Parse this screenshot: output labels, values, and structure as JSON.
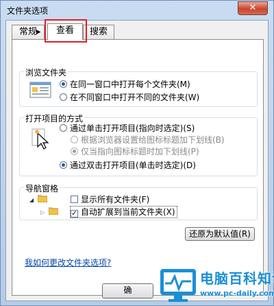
{
  "window": {
    "title": "文件夹选项",
    "close_glyph": "✕"
  },
  "tabs": [
    {
      "label": "常规"
    },
    {
      "label": "查看"
    },
    {
      "label": "搜索"
    }
  ],
  "browse_group": {
    "title": "浏览文件夹",
    "options": [
      {
        "label": "在同一窗口中打开每个文件夹(M)",
        "selected": true
      },
      {
        "label": "在不同窗口中打开不同的文件夹(W)",
        "selected": false
      }
    ]
  },
  "open_group": {
    "title": "打开项目的方式",
    "options": [
      {
        "label": "通过单击打开项目(指向时选定)(S)",
        "selected": false
      },
      {
        "label": "根据浏览器设置给图标标题加下划线(B)",
        "selected": false,
        "disabled": true
      },
      {
        "label": "仅当指向图标标题时加下划线(P)",
        "selected": true,
        "disabled": true
      },
      {
        "label": "通过双击打开项目(单击时选定)(D)",
        "selected": true
      }
    ]
  },
  "nav_group": {
    "title": "导航窗格",
    "options": [
      {
        "label": "显示所有文件夹(F)",
        "checked": false
      },
      {
        "label": "自动扩展到当前文件夹(X)",
        "checked": true
      }
    ]
  },
  "restore_button": "还原为默认值(R)",
  "help_link": "我如何更改文件夹选项?",
  "ok_button": "确",
  "watermark": {
    "name": "电脑百科知识",
    "url": "www.pc-daily.com"
  },
  "colors": {
    "accent": "#2b59a0",
    "link": "#0645ad",
    "highlight": "#e0202a",
    "watermark": "#1a8fd6"
  }
}
